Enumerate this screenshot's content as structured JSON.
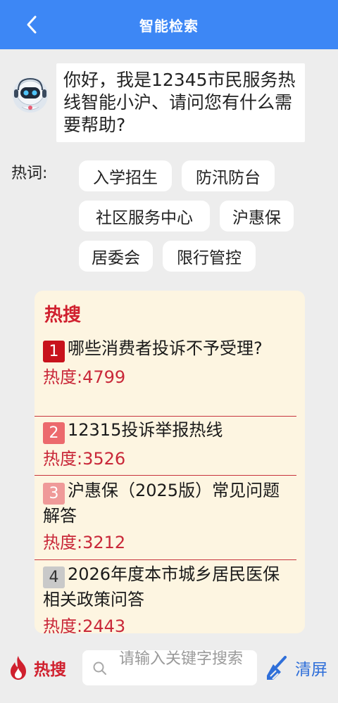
{
  "header": {
    "title": "智能检索",
    "back_icon": "chevron-left-icon"
  },
  "greeting": {
    "avatar_icon": "robot-assistant-icon",
    "message": "你好，我是12345市民服务热线智能小沪、请问您有什么需要帮助?"
  },
  "hot_words": {
    "label": "热词:",
    "chips": [
      "入学招生",
      "防汛防台",
      "社区服务中心",
      "沪惠保",
      "居委会",
      "限行管控"
    ]
  },
  "hot_search": {
    "title": "热搜",
    "items": [
      {
        "rank": "1",
        "question": "哪些消费者投诉不予受理?",
        "heat": "热度:4799"
      },
      {
        "rank": "2",
        "question": "12315投诉举报热线",
        "heat": "热度:3526"
      },
      {
        "rank": "3",
        "question": "沪惠保（2025版）常见问题解答",
        "heat": "热度:3212"
      },
      {
        "rank": "4",
        "question": "2026年度本市城乡居民医保相关政策问答",
        "heat": "热度:2443"
      }
    ]
  },
  "bottom_bar": {
    "hot_label": "热搜",
    "hot_icon": "fire-icon",
    "search_placeholder": "请输入关键字搜索",
    "search_icon": "search-icon",
    "clear_label": "清屏",
    "clear_icon": "broom-icon"
  },
  "colors": {
    "header_bg": "#3d87f5",
    "accent_red": "#d0202e",
    "card_bg": "#fdf5e1",
    "clear_blue": "#2f6fd9"
  }
}
